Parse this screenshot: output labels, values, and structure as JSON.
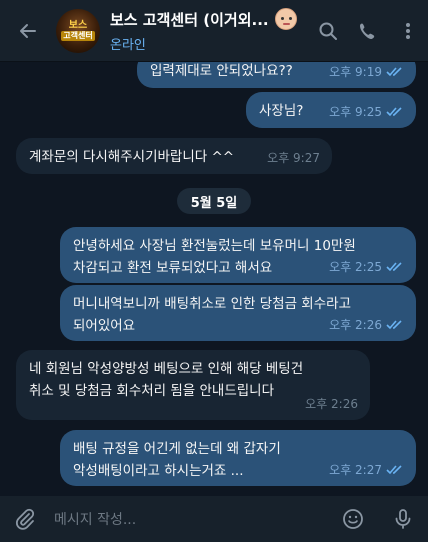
{
  "header": {
    "title": "보스 고객센터 (이거외...",
    "status": "온라인",
    "avatar_text_top": "보스",
    "avatar_text_bottom": "고객센터"
  },
  "messages": [
    {
      "direction": "out",
      "text": "입력제대로 안되었나요??",
      "time": "오후 9:19",
      "read": true
    },
    {
      "direction": "out",
      "text": "사장님?",
      "time": "오후 9:25",
      "read": true
    },
    {
      "direction": "in",
      "text": "계좌문의 다시해주시기바랍니다 ^^",
      "time": "오후 9:27"
    },
    {
      "direction": "out",
      "text_lines": [
        "안녕하세요 사장님 환전눌렀는데 보유머니 10만원",
        "차감되고 환전 보류되었다고 해서요"
      ],
      "time": "오후 2:25",
      "read": true
    },
    {
      "direction": "out",
      "text_lines": [
        "머니내역보니까 배팅취소로 인한 당첨금 회수라고",
        "되어있어요"
      ],
      "time": "오후 2:26",
      "read": true
    },
    {
      "direction": "in",
      "text_lines": [
        "네 회원님 악성양방성 베팅으로 인해 해당 베팅건",
        "취소 및 당첨금 회수처리 됨을 안내드립니다"
      ],
      "time": "오후 2:26"
    },
    {
      "direction": "out",
      "text_lines": [
        "배팅 규정을 어긴게 없는데 왜 갑자기",
        "악성배팅이라고 하시는거죠 ..."
      ],
      "time": "오후 2:27",
      "read": true
    }
  ],
  "date_separator": "5월 5일",
  "composer": {
    "placeholder": "메시지 작성..."
  },
  "icons": {
    "back": "arrow-left-icon",
    "search": "search-icon",
    "call": "phone-icon",
    "menu": "more-vertical-icon",
    "attach": "paperclip-icon",
    "emoji": "emoji-icon",
    "mic": "microphone-icon",
    "read": "double-check-icon"
  },
  "colors": {
    "background": "#0e1621",
    "header": "#17212b",
    "outgoing_bubble": "#2b5278",
    "incoming_bubble": "#182533",
    "accent": "#6ab3f3"
  }
}
